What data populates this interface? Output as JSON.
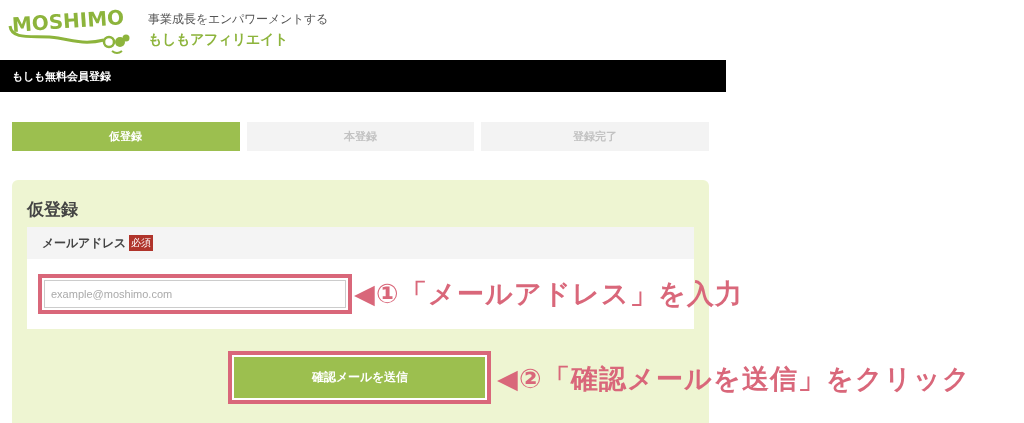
{
  "logo": {
    "text": "MOSHIMO",
    "tagline": "事業成長をエンパワーメントする",
    "name": "もしもアフィリエイト"
  },
  "header_bar": {
    "title": "もしも無料会員登録"
  },
  "steps": [
    {
      "label": "仮登録",
      "selected": true
    },
    {
      "label": "本登録",
      "selected": false
    },
    {
      "label": "登録完了",
      "selected": false
    }
  ],
  "form": {
    "heading": "仮登録",
    "field_label": "メールアドレス",
    "required_badge": "必須",
    "email": {
      "placeholder": "example@moshimo.com"
    },
    "submit_button": "確認メールを送信"
  },
  "annotations": [
    {
      "text": "◀①「メールアドレス」を入力"
    },
    {
      "text": "◀②「確認メールを送信」をクリック"
    }
  ]
}
